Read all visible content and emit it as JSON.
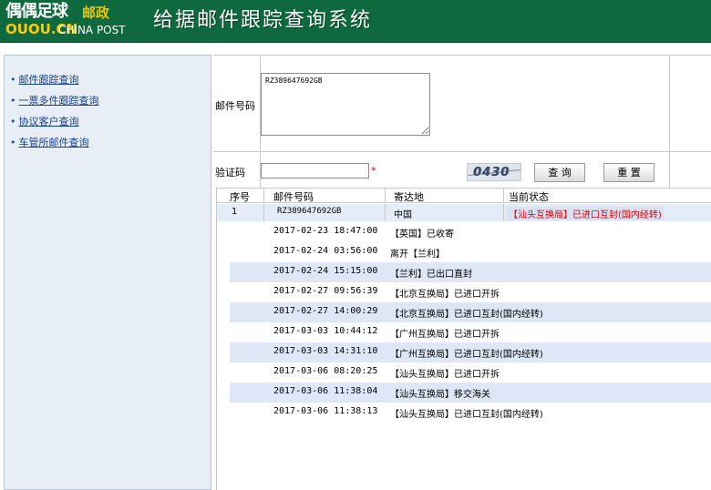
{
  "header": {
    "logo_watermark_top": "偶偶足球",
    "logo_watermark_bottom": "OUOU.CN",
    "logo_brand_cn": "邮政",
    "logo_brand_en": "CHINA POST",
    "title": "给据邮件跟踪查询系统"
  },
  "sidebar": {
    "items": [
      {
        "label": "邮件跟踪查询"
      },
      {
        "label": "一票多件跟踪查询"
      },
      {
        "label": "协议客户查询"
      },
      {
        "label": "车管所邮件查询"
      }
    ]
  },
  "form": {
    "mail_label": "邮件号码",
    "mail_value": "RZ389647692GB",
    "verify_label": "验证码",
    "required_mark": "*",
    "captcha_text": "0430",
    "query_button": "查 询",
    "reset_button": "重 置"
  },
  "results": {
    "headers": [
      "序号",
      "邮件号码",
      "寄达地",
      "当前状态"
    ],
    "main": {
      "index": "1",
      "mail_no": "RZ389647692GB",
      "destination": "中国",
      "status": "【汕头互换局】已进口互封(国内经转)"
    },
    "events": [
      {
        "time": "2017-02-23 18:47:00",
        "event": "【英国】已收寄"
      },
      {
        "time": "2017-02-24 03:56:00",
        "event": "离开【兰利】"
      },
      {
        "time": "2017-02-24 15:15:00",
        "event": "【兰利】已出口直封"
      },
      {
        "time": "2017-02-27 09:56:39",
        "event": "【北京互换局】已进口开拆"
      },
      {
        "time": "2017-02-27 14:00:29",
        "event": "【北京互换局】已进口互封(国内经转)"
      },
      {
        "time": "2017-03-03 10:44:12",
        "event": "【广州互换局】已进口开拆"
      },
      {
        "time": "2017-03-03 14:31:10",
        "event": "【广州互换局】已进口互封(国内经转)"
      },
      {
        "time": "2017-03-06 08:20:25",
        "event": "【汕头互换局】已进口开拆"
      },
      {
        "time": "2017-03-06 11:38:04",
        "event": "【汕头互换局】移交海关"
      },
      {
        "time": "2017-03-06 11:38:13",
        "event": "【汕头互换局】已进口互封(国内经转)"
      }
    ]
  },
  "colors": {
    "header_bg": "#0e6a3e",
    "status_red": "#e00000",
    "row_shade": "#dde7f5",
    "sidebar_bg": "#e8eef5"
  }
}
